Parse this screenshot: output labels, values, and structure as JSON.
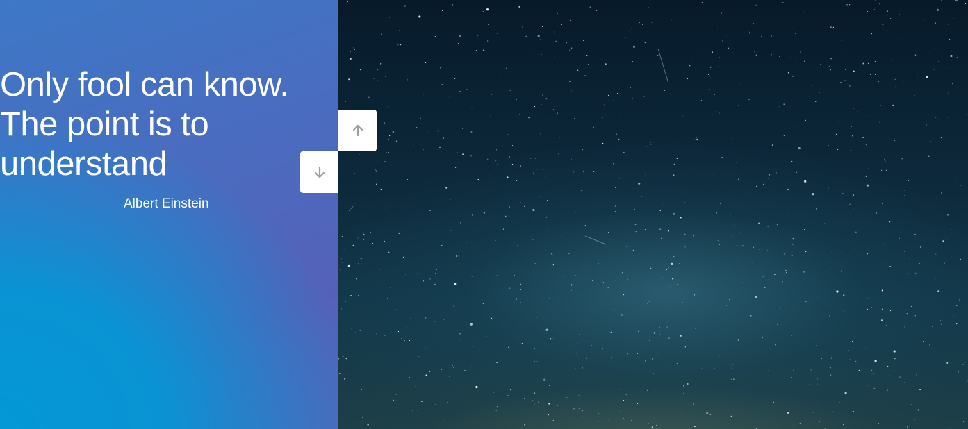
{
  "slide": {
    "quote_line_1": "Only fool can know.",
    "quote_line_2": "The point is to",
    "quote_line_3": "understand",
    "author": "Albert Einstein"
  },
  "navigation": {
    "up_icon": "arrow-up-icon",
    "down_icon": "arrow-down-icon"
  },
  "colors": {
    "left_panel_top": "#4a6cc0",
    "left_panel_bottom": "#0398d6",
    "sky_dark": "#071a2a",
    "text": "#ffffff",
    "arrow": "#9e9e9e"
  }
}
